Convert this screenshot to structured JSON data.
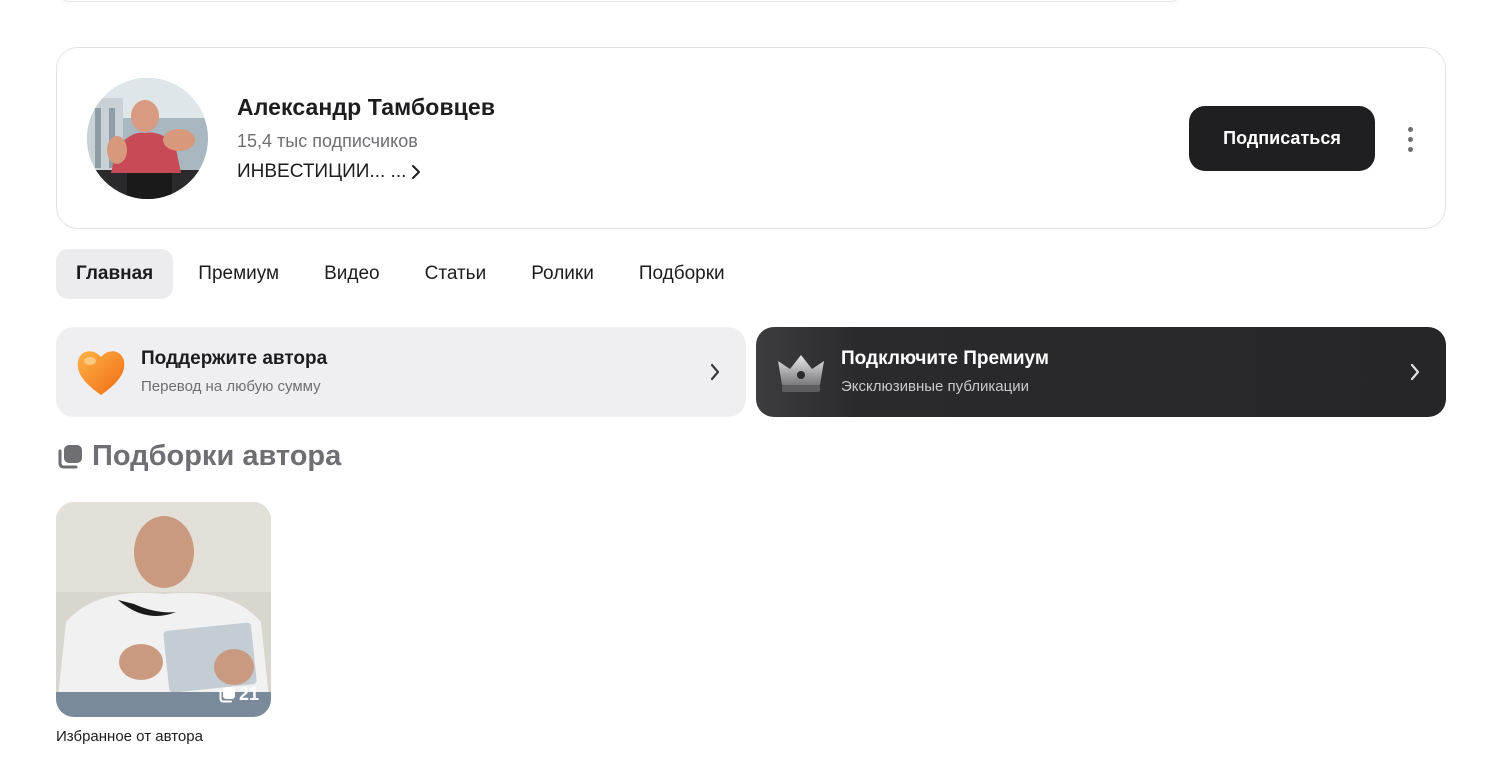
{
  "profile": {
    "name": "Александр Тамбовцев",
    "subscribers": "15,4 тыс подписчиков",
    "description": "ИНВЕСТИЦИИ... ...",
    "subscribe_label": "Подписаться"
  },
  "tabs": [
    {
      "label": "Главная",
      "active": true
    },
    {
      "label": "Премиум",
      "active": false
    },
    {
      "label": "Видео",
      "active": false
    },
    {
      "label": "Статьи",
      "active": false
    },
    {
      "label": "Ролики",
      "active": false
    },
    {
      "label": "Подборки",
      "active": false
    }
  ],
  "promos": {
    "support": {
      "title": "Поддержите автора",
      "subtitle": "Перевод на любую сумму",
      "icon": "heart-icon"
    },
    "premium": {
      "title": "Подключите Премиум",
      "subtitle": "Эксклюзивные публикации",
      "icon": "crown-icon"
    }
  },
  "collections": {
    "heading": "Подборки автора",
    "items": [
      {
        "count": "21",
        "caption": "Избранное от автора"
      }
    ]
  },
  "colors": {
    "accent_dark": "#1f1f21",
    "tab_active_bg": "#ececef",
    "support_bg": "#efeff1",
    "heart_orange": "#ff8a1f",
    "muted_text": "#6e6e73"
  }
}
